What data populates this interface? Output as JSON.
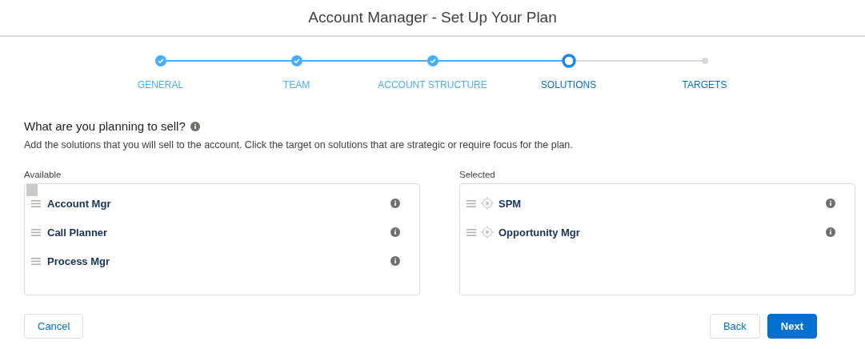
{
  "title": "Account Manager - Set Up Your Plan",
  "steps": [
    {
      "label": "GENERAL",
      "kind": "done"
    },
    {
      "label": "TEAM",
      "kind": "done"
    },
    {
      "label": "ACCOUNT STRUCTURE",
      "kind": "done"
    },
    {
      "label": "SOLUTIONS",
      "kind": "current"
    },
    {
      "label": "TARGETS",
      "kind": "pending"
    }
  ],
  "heading": "What are you planning to sell?",
  "description": "Add the solutions that you will sell to the account. Click the target on solutions that are strategic or require focus for the plan.",
  "available": {
    "label": "Available",
    "items": [
      {
        "name": "Account Mgr"
      },
      {
        "name": "Call Planner"
      },
      {
        "name": "Process Mgr"
      }
    ]
  },
  "selected": {
    "label": "Selected",
    "items": [
      {
        "name": "SPM",
        "strategic": false
      },
      {
        "name": "Opportunity Mgr",
        "strategic": false
      }
    ]
  },
  "buttons": {
    "cancel": "Cancel",
    "back": "Back",
    "next": "Next"
  }
}
